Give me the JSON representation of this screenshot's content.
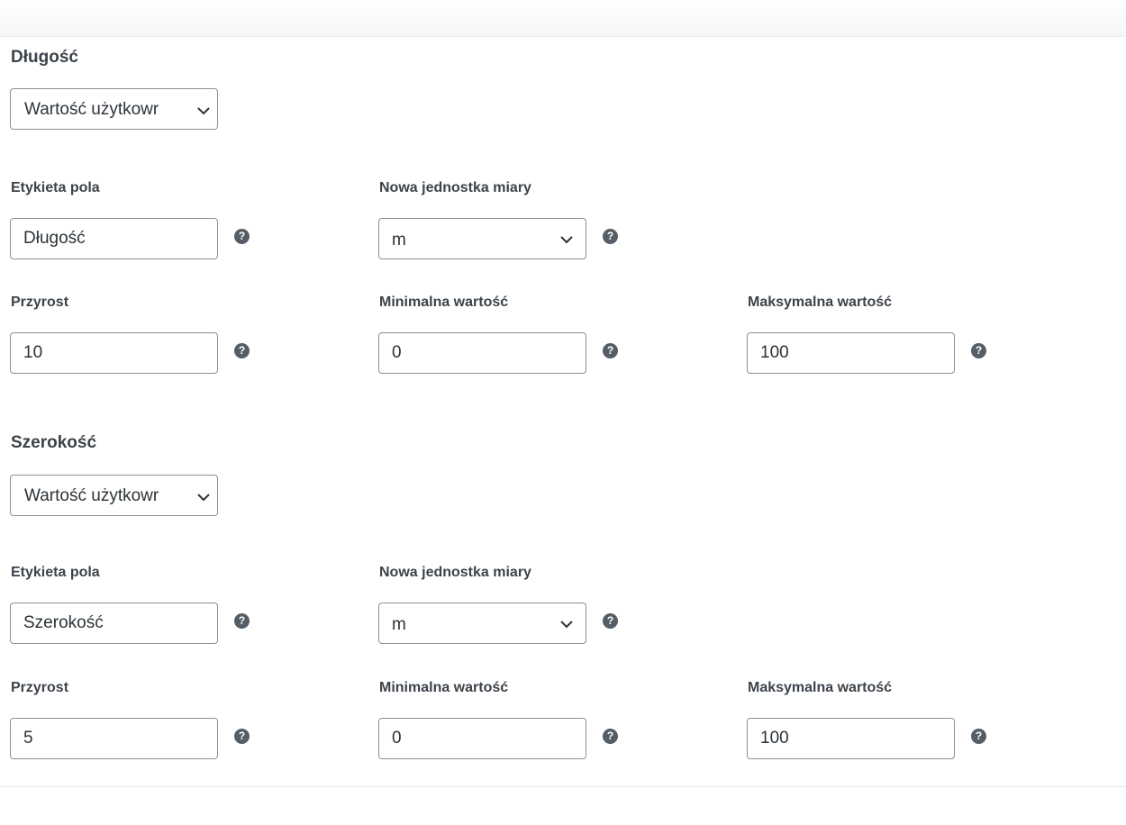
{
  "sections": [
    {
      "title": "Długość",
      "mode_select": {
        "value": "Wartość użytkowr"
      },
      "field_label": {
        "label": "Etykieta pola",
        "value": "Długość"
      },
      "unit": {
        "label": "Nowa jednostka miary",
        "value": "m"
      },
      "increment": {
        "label": "Przyrost",
        "value": "10"
      },
      "min": {
        "label": "Minimalna wartość",
        "value": "0"
      },
      "max": {
        "label": "Maksymalna wartość",
        "value": "100"
      }
    },
    {
      "title": "Szerokość",
      "mode_select": {
        "value": "Wartość użytkowr"
      },
      "field_label": {
        "label": "Etykieta pola",
        "value": "Szerokość"
      },
      "unit": {
        "label": "Nowa jednostka miary",
        "value": "m"
      },
      "increment": {
        "label": "Przyrost",
        "value": "5"
      },
      "min": {
        "label": "Minimalna wartość",
        "value": "0"
      },
      "max": {
        "label": "Maksymalna wartość",
        "value": "100"
      }
    }
  ],
  "icons": {
    "help": "question-circle-icon",
    "dropdown": "chevron-down-icon"
  },
  "help_glyph": "?"
}
